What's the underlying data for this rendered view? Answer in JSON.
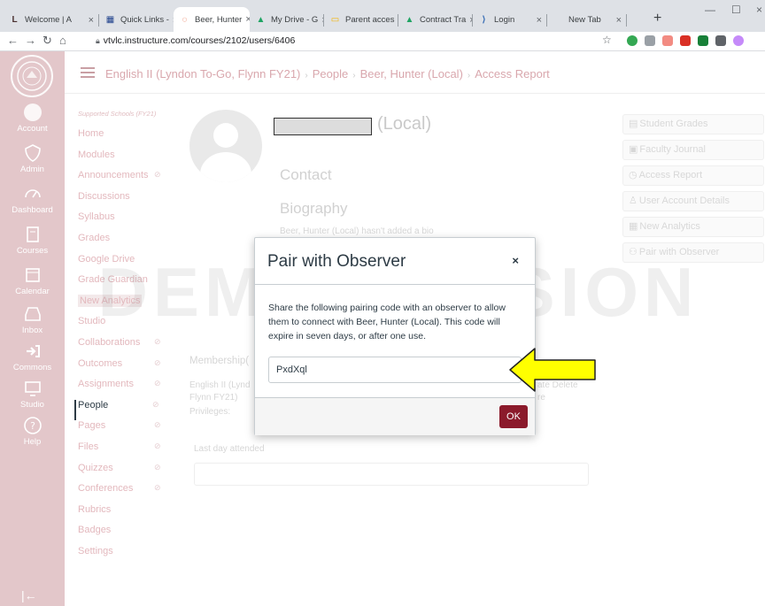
{
  "browser": {
    "tabs": [
      {
        "label": "Welcome | A",
        "fav": "L",
        "favcolor": "#4a2f2f"
      },
      {
        "label": "Quick Links -",
        "fav": "▦",
        "favcolor": "#1d3f8b"
      },
      {
        "label": "Beer, Hunter",
        "fav": "◌",
        "favcolor": "#e4572e"
      },
      {
        "label": "My Drive - G",
        "fav": "▲",
        "favcolor": "#1fa463"
      },
      {
        "label": "Parent acces",
        "fav": "▭",
        "favcolor": "#f4b400"
      },
      {
        "label": "Contract Tra",
        "fav": "▲",
        "favcolor": "#1fa463"
      },
      {
        "label": "Login",
        "fav": "⟩",
        "favcolor": "#3b6fb6"
      },
      {
        "label": "New Tab",
        "fav": "",
        "favcolor": "#fff"
      }
    ],
    "url": "vtvlc.instructure.com/courses/2102/users/6406"
  },
  "global_nav": [
    {
      "label": "Account",
      "icon": "avatar-icon"
    },
    {
      "label": "Admin",
      "icon": "shield-icon"
    },
    {
      "label": "Dashboard",
      "icon": "dashboard-icon"
    },
    {
      "label": "Courses",
      "icon": "book-icon"
    },
    {
      "label": "Calendar",
      "icon": "calendar-icon"
    },
    {
      "label": "Inbox",
      "icon": "inbox-icon"
    },
    {
      "label": "Commons",
      "icon": "commons-icon"
    },
    {
      "label": "Studio",
      "icon": "studio-icon"
    },
    {
      "label": "Help",
      "icon": "help-icon"
    }
  ],
  "header": {
    "crumbs": [
      "English II (Lyndon To-Go, Flynn FY21)",
      "People",
      "Beer, Hunter (Local)",
      "Access Report"
    ]
  },
  "course_nav": {
    "subtitle": "Supported Schools (FY21)",
    "items": [
      {
        "label": "Home",
        "hidden": false
      },
      {
        "label": "Modules",
        "hidden": false
      },
      {
        "label": "Announcements",
        "hidden": true
      },
      {
        "label": "Discussions",
        "hidden": false
      },
      {
        "label": "Syllabus",
        "hidden": false
      },
      {
        "label": "Grades",
        "hidden": false
      },
      {
        "label": "Google Drive",
        "hidden": false
      },
      {
        "label": "Grade Guardian",
        "hidden": false
      },
      {
        "label": "New Analytics",
        "hidden": false
      },
      {
        "label": "Studio",
        "hidden": false
      },
      {
        "label": "Collaborations",
        "hidden": true
      },
      {
        "label": "Outcomes",
        "hidden": true
      },
      {
        "label": "Assignments",
        "hidden": true
      },
      {
        "label": "People",
        "hidden": true
      },
      {
        "label": "Pages",
        "hidden": true
      },
      {
        "label": "Files",
        "hidden": true
      },
      {
        "label": "Quizzes",
        "hidden": true
      },
      {
        "label": "Conferences",
        "hidden": true
      },
      {
        "label": "Rubrics",
        "hidden": false
      },
      {
        "label": "Badges",
        "hidden": false
      },
      {
        "label": "Settings",
        "hidden": false
      }
    ]
  },
  "profile": {
    "name_suffix": "(Local)",
    "contact": "Contact",
    "biography": "Biography",
    "bio_text": "Beer, Hunter (Local) hasn't added a bio",
    "membership": "Membership(",
    "course_line1": "English II (Lynd",
    "course_line2": "Flynn FY21)",
    "privileges": "Privileges:",
    "delete": "ate Delete",
    "role_tail": "re",
    "last_day": "Last day attended"
  },
  "right_buttons": [
    {
      "label": "Student Grades",
      "icon": "grades-icon"
    },
    {
      "label": "Faculty Journal",
      "icon": "journal-icon"
    },
    {
      "label": "Access Report",
      "icon": "clock-icon"
    },
    {
      "label": "User Account Details",
      "icon": "user-icon"
    },
    {
      "label": "New Analytics",
      "icon": "analytics-icon"
    },
    {
      "label": "Pair with Observer",
      "icon": "pair-icon"
    }
  ],
  "watermark": "DEMO VERSION",
  "modal": {
    "title": "Pair with Observer",
    "close": "×",
    "message": "Share the following pairing code with an observer to allow them to connect with Beer, Hunter (Local). This code will expire in seven days, or after one use.",
    "code": "PxdXql",
    "ok": "OK"
  }
}
